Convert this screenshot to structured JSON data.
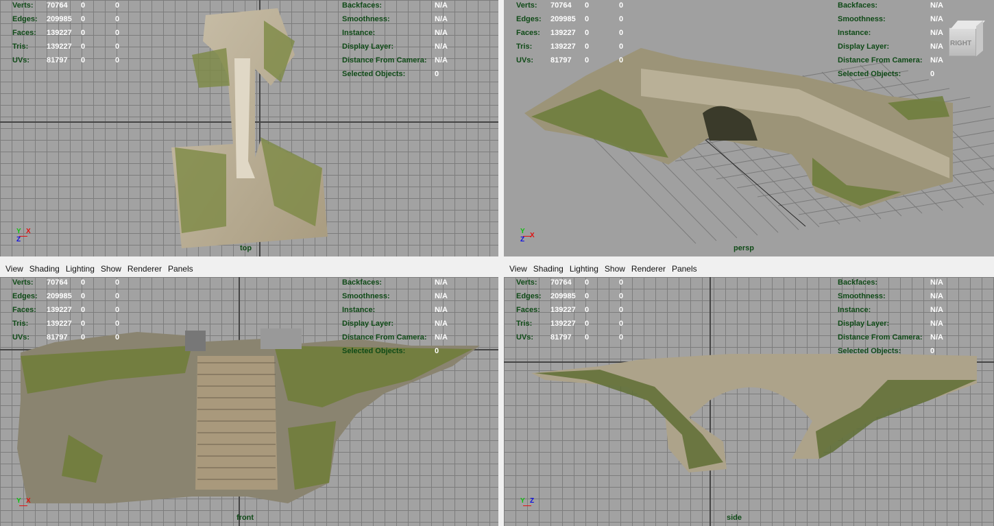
{
  "menu": [
    "View",
    "Shading",
    "Lighting",
    "Show",
    "Renderer",
    "Panels"
  ],
  "stats": {
    "rows": [
      {
        "label": "Verts:",
        "value": "70764",
        "sel": "0",
        "comp": "0"
      },
      {
        "label": "Edges:",
        "value": "209985",
        "sel": "0",
        "comp": "0"
      },
      {
        "label": "Faces:",
        "value": "139227",
        "sel": "0",
        "comp": "0"
      },
      {
        "label": "Tris:",
        "value": "139227",
        "sel": "0",
        "comp": "0"
      },
      {
        "label": "UVs:",
        "value": "81797",
        "sel": "0",
        "comp": "0"
      }
    ],
    "info": [
      {
        "label": "Backfaces:",
        "value": "N/A"
      },
      {
        "label": "Smoothness:",
        "value": "N/A"
      },
      {
        "label": "Instance:",
        "value": "N/A"
      },
      {
        "label": "Display Layer:",
        "value": "N/A"
      },
      {
        "label": "Distance From Camera:",
        "value": "N/A"
      },
      {
        "label": "Selected Objects:",
        "value": "0"
      }
    ]
  },
  "viewports": [
    {
      "camera": "top",
      "axes": [
        "Y",
        "X",
        "Z"
      ]
    },
    {
      "camera": "persp",
      "axes": [
        "Y",
        "X",
        "Z"
      ],
      "view_cube": "RIGHT"
    },
    {
      "camera": "front",
      "axes": [
        "Y",
        "X"
      ]
    },
    {
      "camera": "side",
      "axes": [
        "Y",
        "Z"
      ]
    }
  ],
  "colors": {
    "hud_label": "#0f4a17",
    "hud_value": "#ffffff",
    "viewport_bg": "#a2a2a2",
    "grid": "#7c7c7c"
  }
}
